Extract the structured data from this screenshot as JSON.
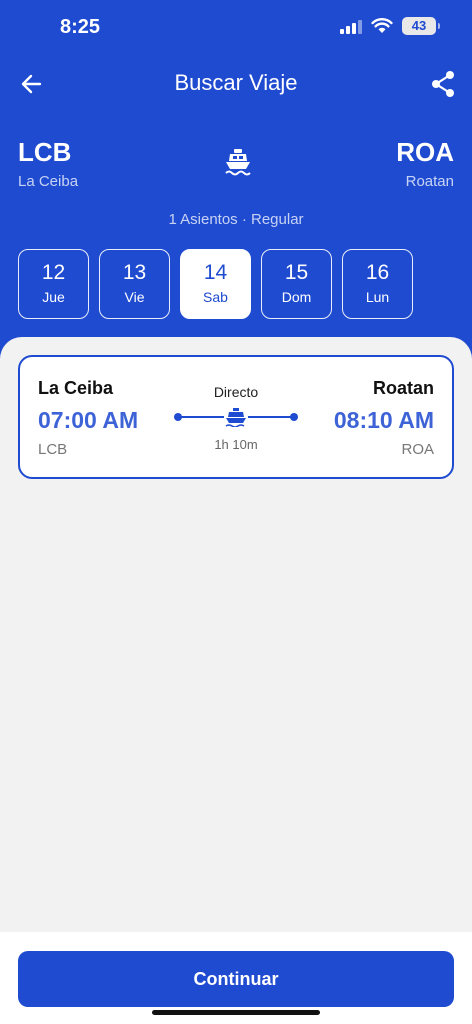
{
  "status": {
    "time": "8:25",
    "battery": "43"
  },
  "nav": {
    "title": "Buscar Viaje",
    "back_icon": "arrow-left-icon",
    "share_icon": "share-icon"
  },
  "route": {
    "origin": {
      "code": "LCB",
      "name": "La Ceiba"
    },
    "destination": {
      "code": "ROA",
      "name": "Roatan"
    },
    "mode_icon": "ferry-icon"
  },
  "summary": "1 Asientos · Regular",
  "dates": [
    {
      "num": "12",
      "day": "Jue",
      "selected": false
    },
    {
      "num": "13",
      "day": "Vie",
      "selected": false
    },
    {
      "num": "14",
      "day": "Sab",
      "selected": true
    },
    {
      "num": "15",
      "day": "Dom",
      "selected": false
    },
    {
      "num": "16",
      "day": "Lun",
      "selected": false
    }
  ],
  "trip": {
    "origin_name": "La Ceiba",
    "origin_code": "LCB",
    "departure": "07:00 AM",
    "destination_name": "Roatan",
    "destination_code": "ROA",
    "arrival": "08:10 AM",
    "type": "Directo",
    "duration": "1h 10m"
  },
  "footer": {
    "continue_label": "Continuar"
  },
  "colors": {
    "primary": "#1f4bd1",
    "time_accent": "#3e63d6",
    "background": "#f2f2f2"
  }
}
